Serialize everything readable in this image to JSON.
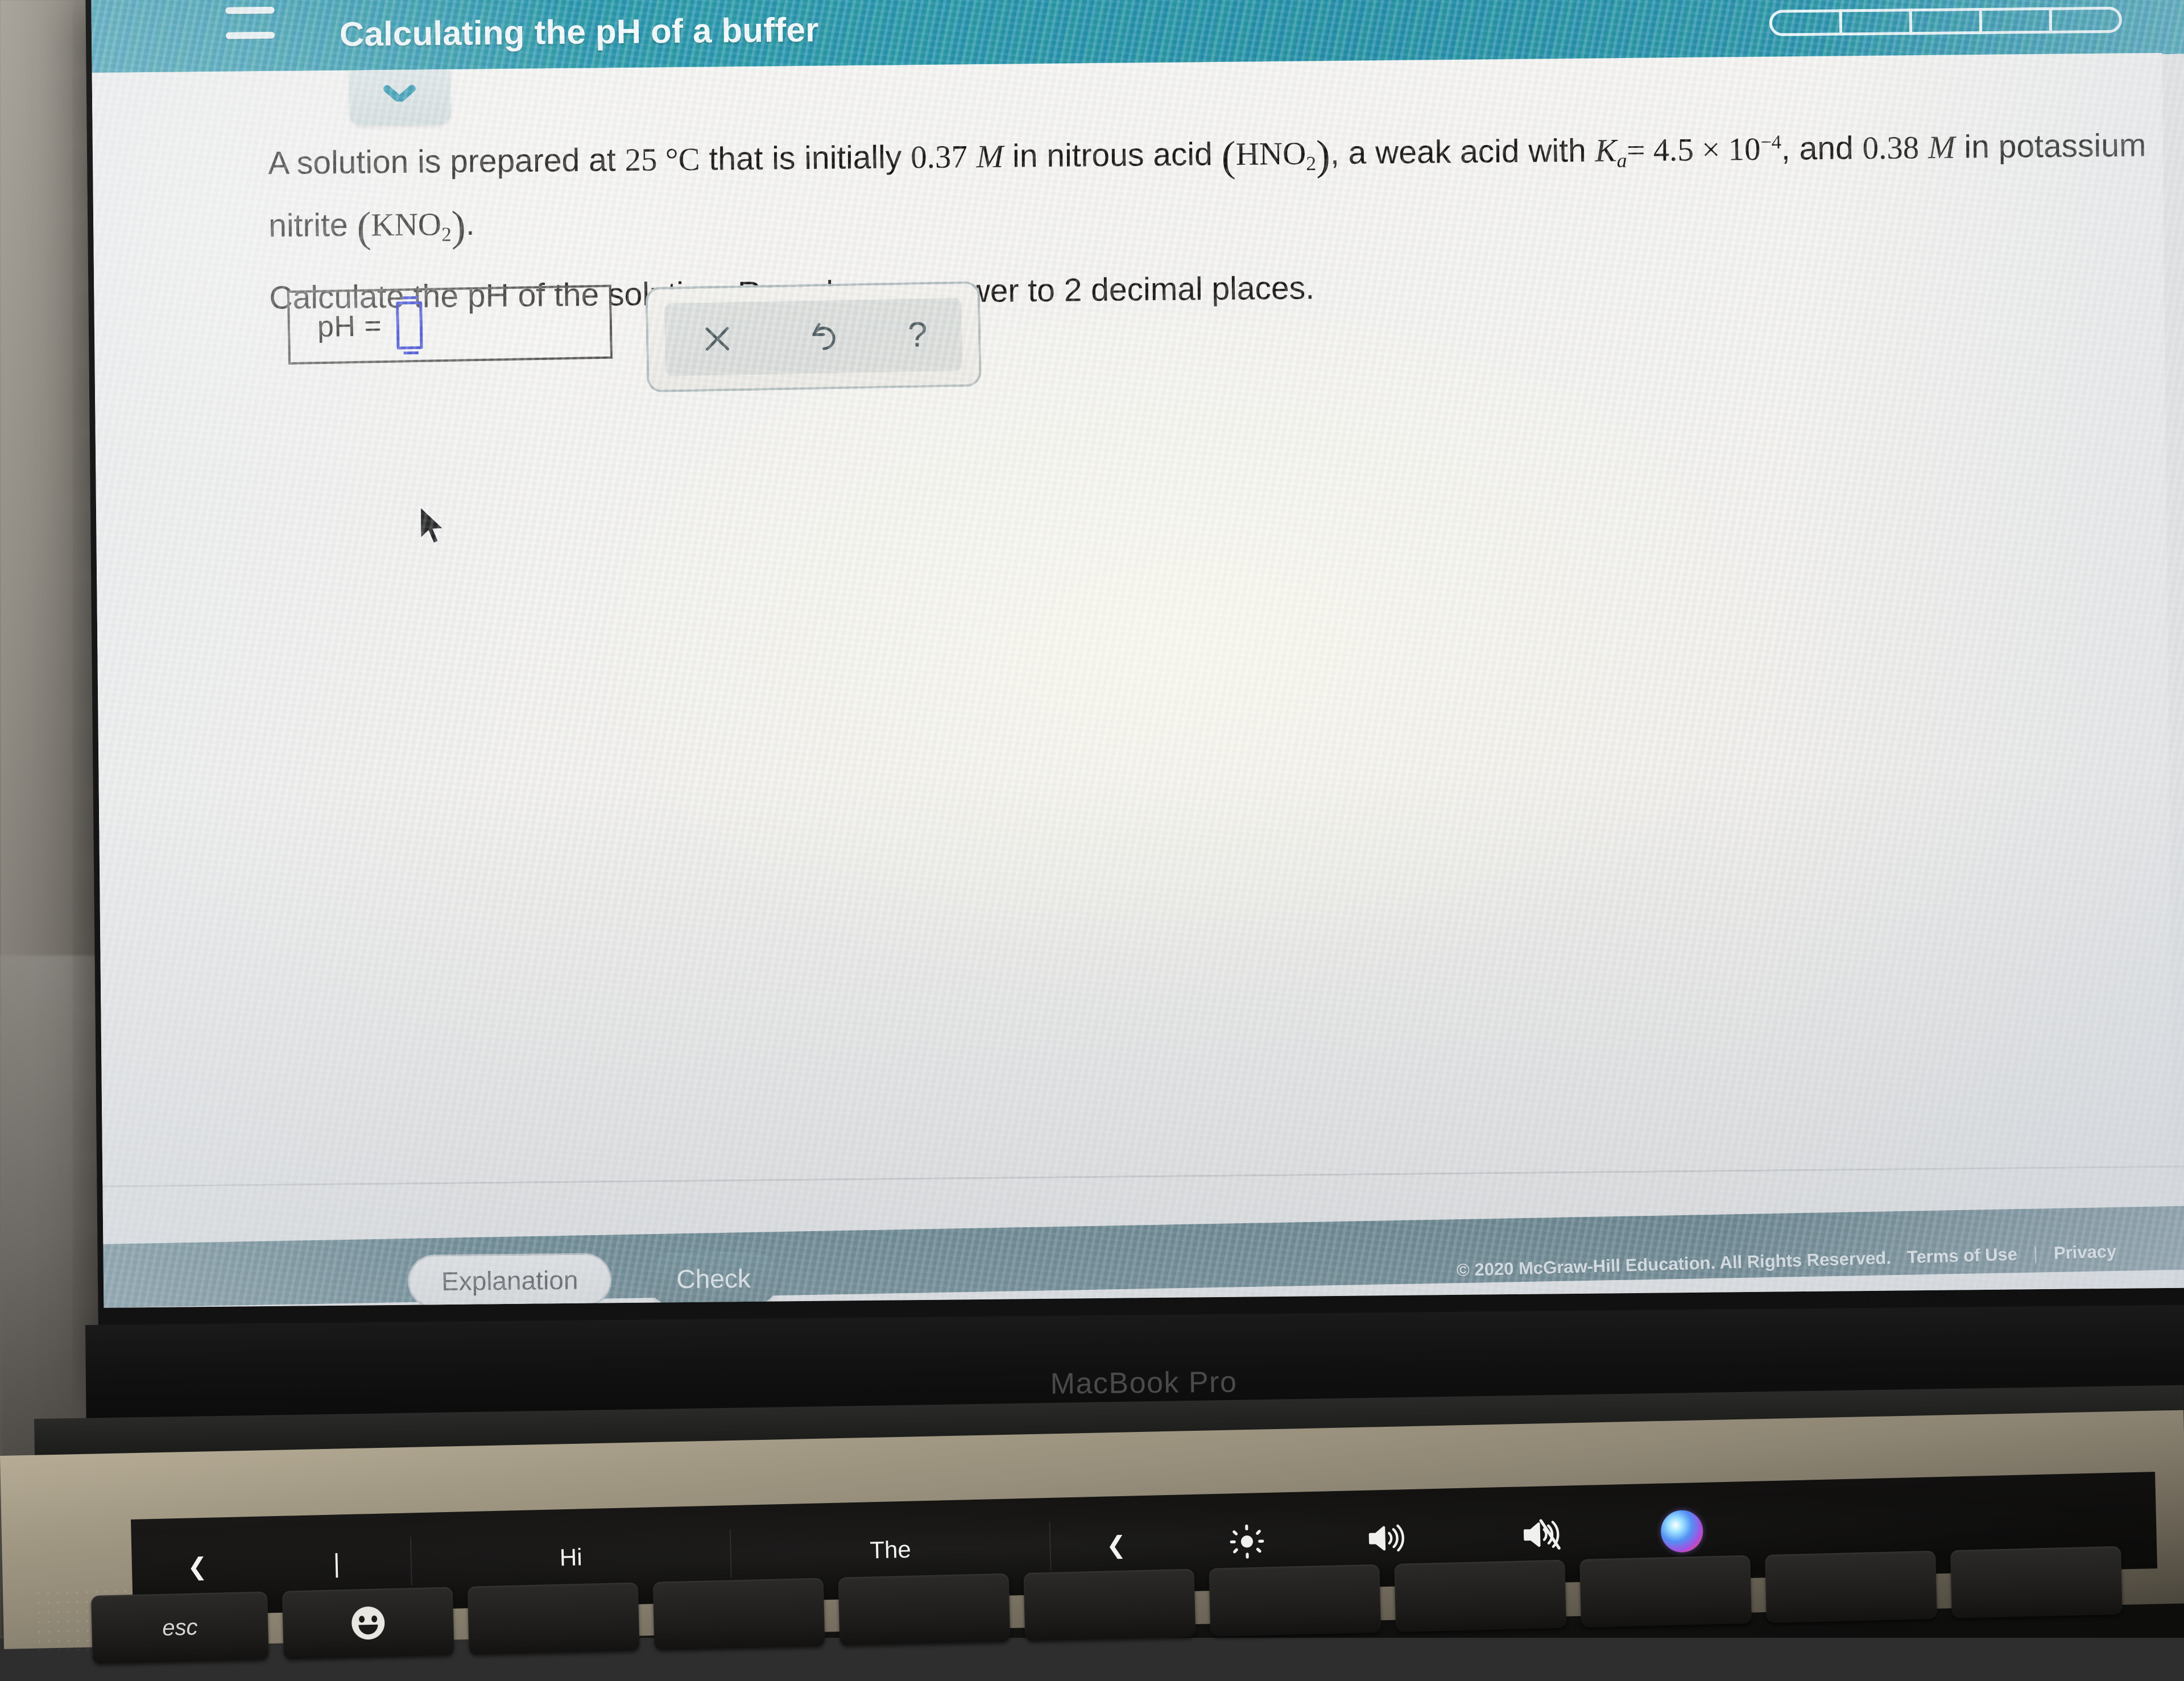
{
  "app": {
    "header": {
      "title": "Calculating the pH of a buffer",
      "menu_icon": "hamburger-icon",
      "progress_segments": 5,
      "progress_filled": 0,
      "accent_color": "#1d8fab"
    },
    "collapse_tab": {
      "icon": "chevron-down-icon"
    },
    "question": {
      "line1_a": "A solution is prepared at ",
      "temperature": "25 °C",
      "line1_b": " that is initially ",
      "concentration_acid": "0.37",
      "molar_symbol": "M",
      "line1_c": " in nitrous acid ",
      "acid_formula_main": "HNO",
      "acid_formula_sub": "2",
      "line1_d": ", a weak acid with ",
      "ka_symbol": "K",
      "ka_subscript": "a",
      "ka_equals": "= 4.5 × 10",
      "ka_exponent": "−4",
      "line1_e": ", and ",
      "concentration_salt": "0.38",
      "line1_f": " in potassium nitrite ",
      "salt_formula_main": "KNO",
      "salt_formula_sub": "2",
      "line1_g": ".",
      "line2": "Calculate the pH of the solution. Round your answer to 2 decimal places."
    },
    "answer": {
      "label": "pH =",
      "value": "",
      "placeholder": "",
      "input_border_color": "#2d3ad2"
    },
    "toolbar": {
      "clear_icon": "close-x-icon",
      "undo_icon": "undo-arrow-icon",
      "help_icon": "question-mark-icon",
      "clear_label": "×",
      "undo_label": "↺",
      "help_label": "?"
    },
    "footer": {
      "explanation_label": "Explanation",
      "check_label": "Check",
      "check_color": "#355d65",
      "copyright": "© 2020 McGraw-Hill Education. All Rights Reserved.",
      "terms_label": "Terms of Use",
      "separator": "|",
      "privacy_label": "Privacy"
    },
    "cursor": {
      "icon": "mouse-pointer-icon"
    }
  },
  "laptop": {
    "brand_label": "MacBook Pro",
    "touchbar": {
      "back_chevron": "❮",
      "text_bar": "|",
      "suggestion_1": "Hi",
      "suggestion_2": "The",
      "collapse_chevron": "❮",
      "brightness_icon": "brightness-icon",
      "volume_icon": "volume-up-icon",
      "mute_icon": "volume-mute-icon",
      "siri_icon": "siri-orb-icon"
    },
    "keys": {
      "esc_label": "esc",
      "emoji_label": "emoji-key"
    }
  }
}
